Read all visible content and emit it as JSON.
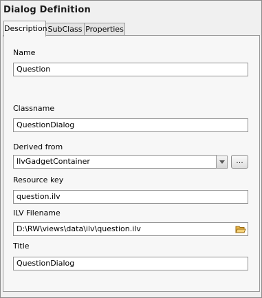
{
  "window": {
    "title": "Dialog Definition"
  },
  "tabs": [
    {
      "label": "Description",
      "active": true
    },
    {
      "label": "SubClass",
      "active": false
    },
    {
      "label": "Properties",
      "active": false
    }
  ],
  "fields": {
    "name": {
      "label": "Name",
      "value": "Question"
    },
    "classname": {
      "label": "Classname",
      "value": "QuestionDialog"
    },
    "derived_from": {
      "label": "Derived from",
      "value": "IlvGadgetContainer",
      "browse_label": "..."
    },
    "resource_key": {
      "label": "Resource key",
      "value": "question.ilv"
    },
    "ilv_filename": {
      "label": "ILV Filename",
      "value": "D:\\RW\\views\\data\\ilv\\question.ilv"
    },
    "title": {
      "label": "Title",
      "value": "QuestionDialog"
    }
  },
  "icons": {
    "combo_arrow": "chevron-down-icon",
    "folder": "folder-open-icon"
  },
  "colors": {
    "folder": "#e8b64a"
  }
}
